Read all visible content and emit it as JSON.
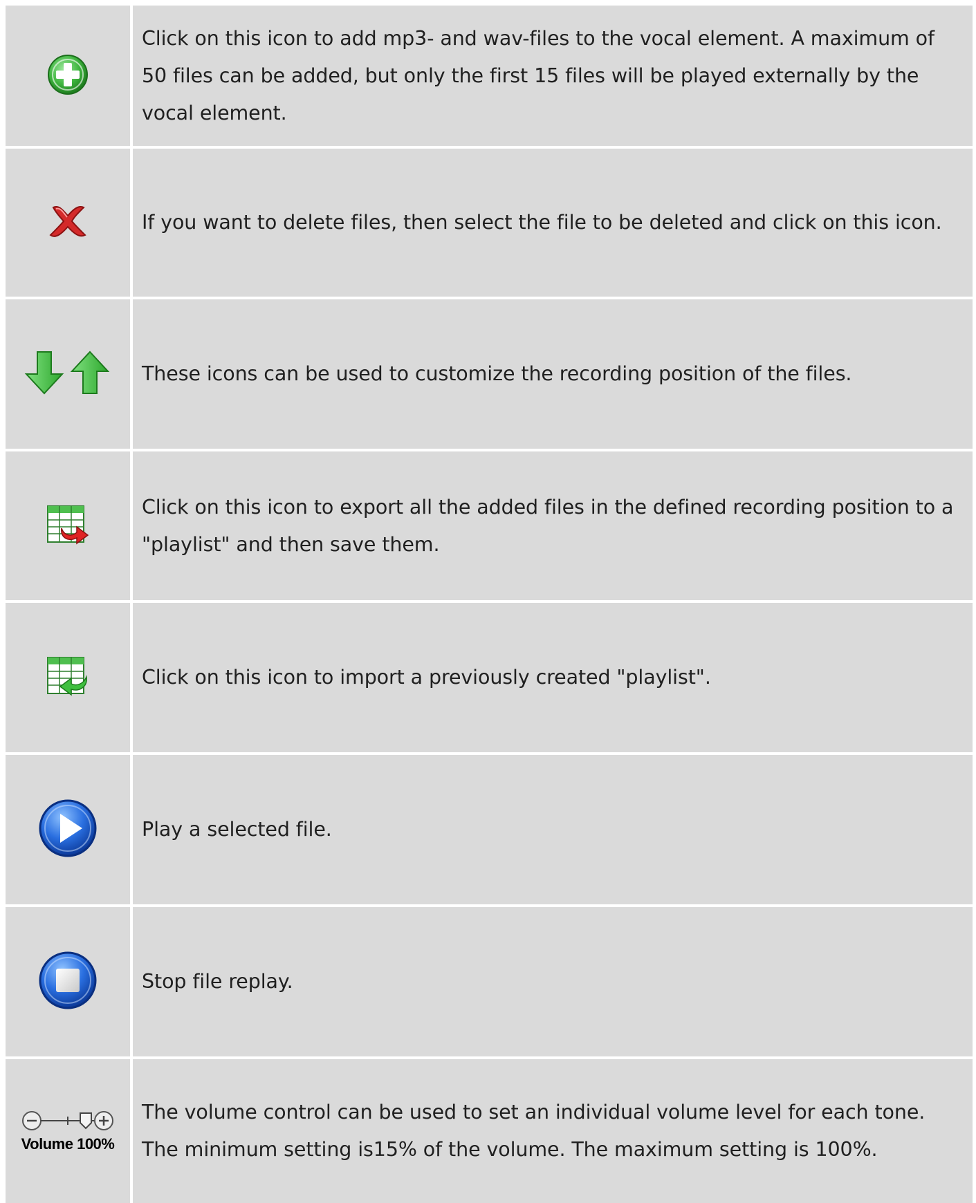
{
  "rows": [
    {
      "icon": "add-circle-icon",
      "text": "Click on this icon to add mp3- and wav-files to the vocal element. A maximum of 50 files can be added, but only the first 15 files will be played externally by the vocal element."
    },
    {
      "icon": "delete-x-icon",
      "text": "If you want to delete files, then select the file to be deleted and click on this icon."
    },
    {
      "icon": "move-down-up-icon",
      "text": "These icons can be used to customize the recording position of the files."
    },
    {
      "icon": "playlist-export-icon",
      "text": "Click on this icon to export all the added files in the defined recording position to a \"playlist\" and then save them."
    },
    {
      "icon": "playlist-import-icon",
      "text": "Click on this icon to import a previously created \"playlist\"."
    },
    {
      "icon": "play-icon",
      "text": "Play a selected file."
    },
    {
      "icon": "stop-icon",
      "text": "Stop file replay."
    },
    {
      "icon": "volume-control-icon",
      "text": "The volume control can be used to set an individual volume level for each tone. The minimum setting is15% of the volume. The maximum setting is 100%.",
      "volume_label": "Volume 100%",
      "volume_percent": 100
    }
  ],
  "colors": {
    "cell_bg": "#dadada",
    "separator": "#ffffff",
    "text": "#202020",
    "green": "#3fb53f",
    "red": "#d42a2a",
    "blue": "#2a6fe0"
  }
}
